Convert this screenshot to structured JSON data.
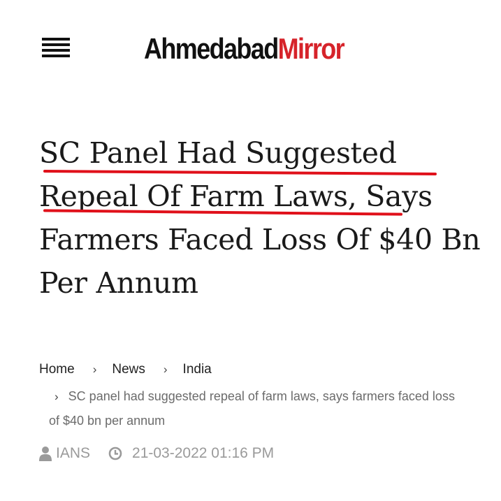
{
  "header": {
    "logo_part1": "Ahmedabad",
    "logo_part2": "Mirror",
    "menu_icon": "hamburger-menu-icon"
  },
  "article": {
    "headline_parts": [
      "SC Panel Had Suggested",
      "Repeal Of Farm Laws,",
      "Says Farmers Faced Loss Of $40 Bn Per Annum"
    ],
    "underline_color": "#e0101a"
  },
  "breadcrumb": {
    "items": [
      "Home",
      "News",
      "India"
    ],
    "separator": "›",
    "current": "SC panel had suggested repeal of farm laws, says farmers faced loss of $40 bn per annum"
  },
  "meta": {
    "author": "IANS",
    "datetime": "21-03-2022 01:16 PM",
    "author_icon": "user-icon",
    "time_icon": "clock-icon"
  },
  "colors": {
    "brand_red": "#d6232a",
    "text": "#1a1a1a",
    "muted": "#9a9a9a"
  }
}
